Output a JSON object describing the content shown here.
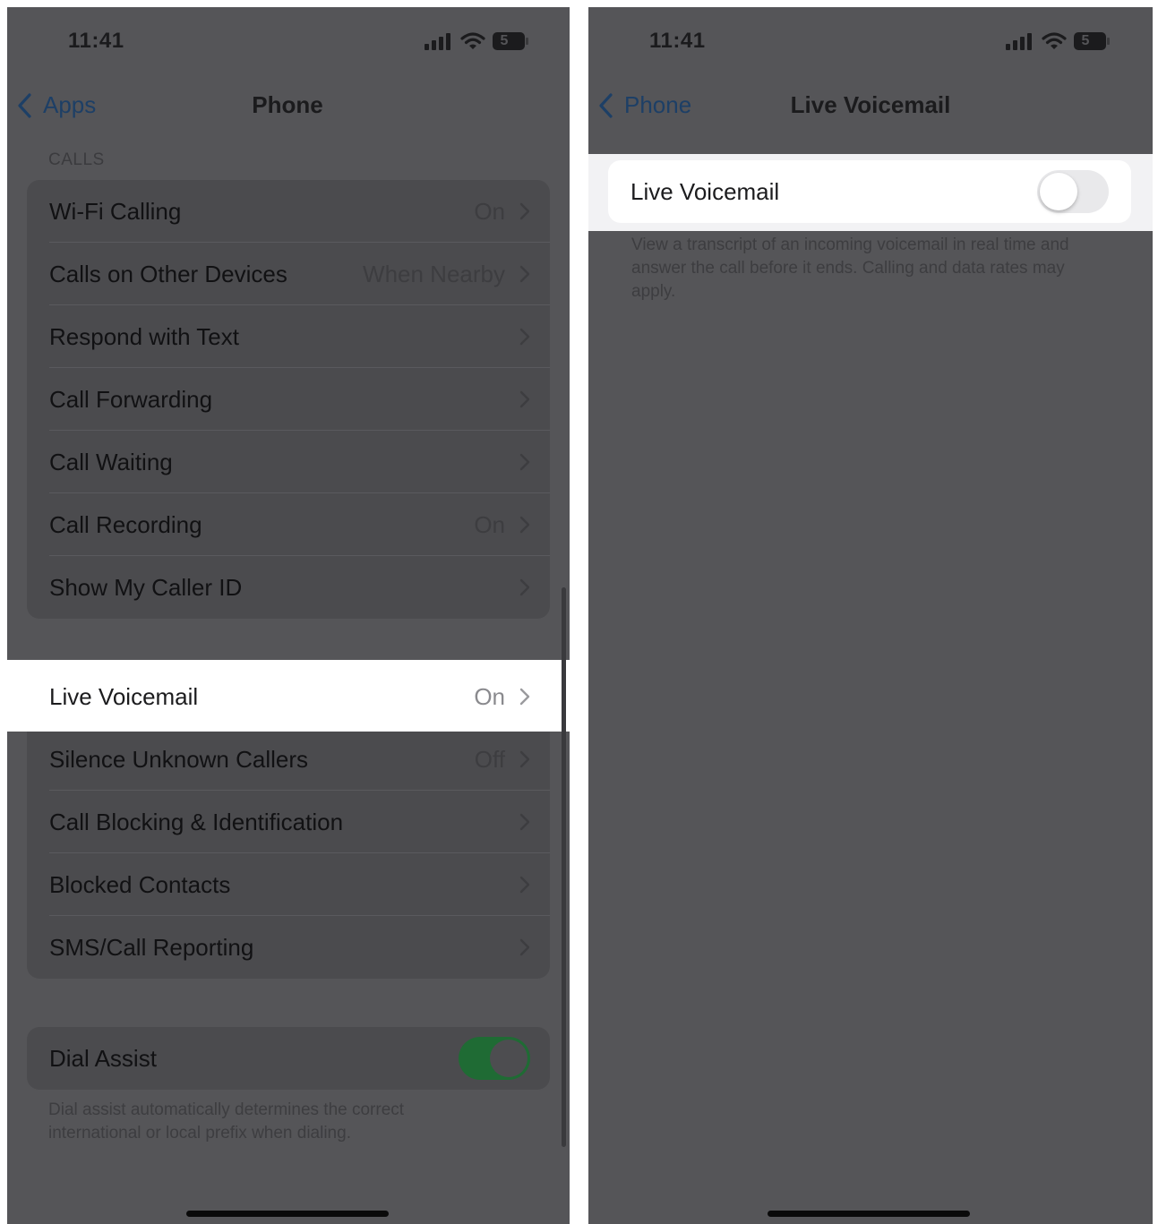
{
  "left_screen": {
    "status": {
      "time": "11:41",
      "battery": "5"
    },
    "nav": {
      "back_label": "Apps",
      "title": "Phone"
    },
    "calls_section_header": "CALLS",
    "calls_rows": [
      {
        "label": "Wi-Fi Calling",
        "value": "On"
      },
      {
        "label": "Calls on Other Devices",
        "value": "When Nearby"
      },
      {
        "label": "Respond with Text",
        "value": ""
      },
      {
        "label": "Call Forwarding",
        "value": ""
      },
      {
        "label": "Call Waiting",
        "value": ""
      },
      {
        "label": "Call Recording",
        "value": "On"
      },
      {
        "label": "Show My Caller ID",
        "value": ""
      }
    ],
    "voicemail_row": {
      "label": "Live Voicemail",
      "value": "On"
    },
    "lower_rows": [
      {
        "label": "Silence Unknown Callers",
        "value": "Off"
      },
      {
        "label": "Call Blocking & Identification",
        "value": ""
      },
      {
        "label": "Blocked Contacts",
        "value": ""
      },
      {
        "label": "SMS/Call Reporting",
        "value": ""
      }
    ],
    "dial_assist": {
      "label": "Dial Assist",
      "enabled": true,
      "footnote": "Dial assist automatically determines the correct international or local prefix when dialing."
    }
  },
  "right_screen": {
    "status": {
      "time": "11:41",
      "battery": "5"
    },
    "nav": {
      "back_label": "Phone",
      "title": "Live Voicemail"
    },
    "toggle_row": {
      "label": "Live Voicemail",
      "enabled": false
    },
    "footnote": "View a transcript of an incoming voicemail in real time and answer the call before it ends. Calling and data rates may apply."
  },
  "colors": {
    "dim_background": "#555558",
    "accent_blue": "#1d3f66",
    "toggle_on_green": "#1f6b34",
    "toggle_off": "#e9e9eb"
  },
  "icons": [
    "signal-icon",
    "wifi-icon",
    "battery-icon",
    "chevron-left-icon",
    "chevron-right-icon"
  ]
}
